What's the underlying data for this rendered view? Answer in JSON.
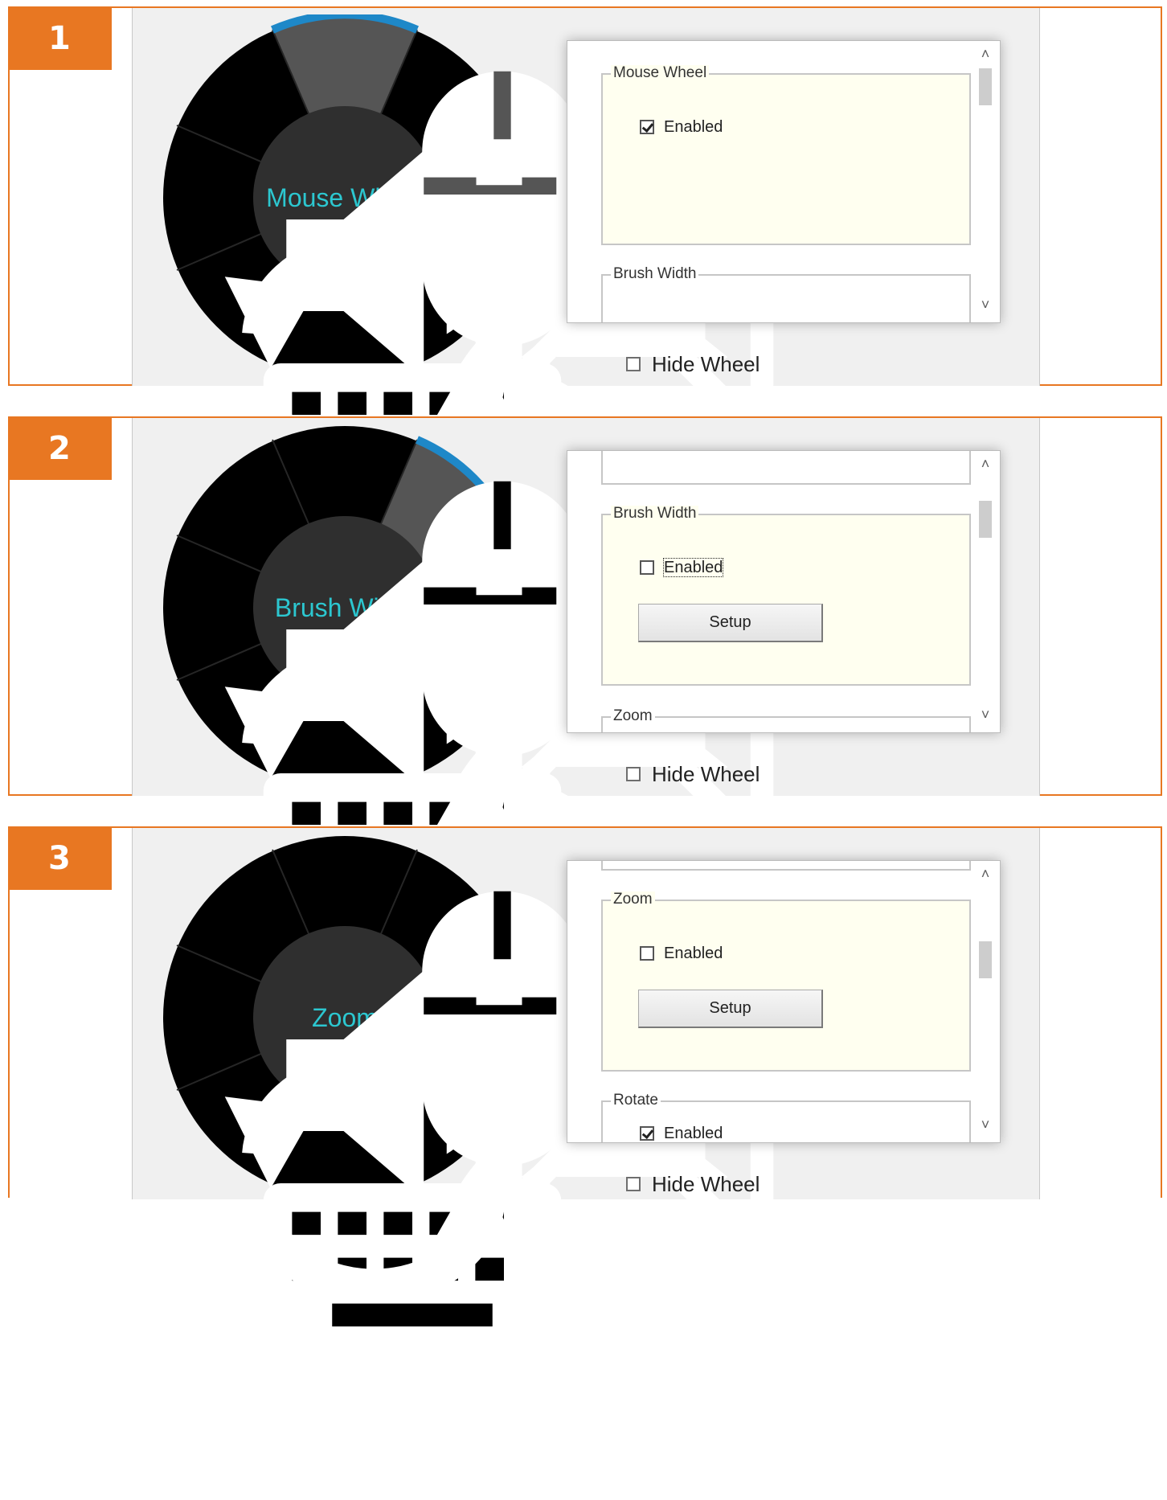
{
  "steps": [
    {
      "number": "1",
      "wheel_label": "Mouse Wheel",
      "groups": [
        {
          "title": "Mouse Wheel",
          "checkbox_label": "Enabled",
          "checked": true
        },
        {
          "title": "Brush Width"
        }
      ],
      "hide_wheel_label": "Hide Wheel",
      "hide_wheel_checked": false
    },
    {
      "number": "2",
      "wheel_label": "Brush Width",
      "groups": [
        {
          "title": "Brush Width",
          "checkbox_label": "Enabled",
          "checked": false,
          "button_label": "Setup"
        },
        {
          "title": "Zoom"
        }
      ],
      "hide_wheel_label": "Hide Wheel",
      "hide_wheel_checked": false
    },
    {
      "number": "3",
      "wheel_label": "Zoom",
      "groups": [
        {
          "title": "Zoom",
          "checkbox_label": "Enabled",
          "checked": false,
          "button_label": "Setup"
        },
        {
          "title": "Rotate",
          "checkbox_label": "Enabled",
          "checked": true
        }
      ],
      "hide_wheel_label": "Hide Wheel",
      "hide_wheel_checked": false
    }
  ],
  "wheel_segments": [
    "mouse-icon",
    "list-icon",
    "fit-screen-icon",
    "rotate-screen-icon",
    "close-icon",
    "keyboard-icon",
    "swap-icon",
    "volume-icon"
  ],
  "scrollbar": {
    "up": "˄",
    "down": "˅"
  },
  "colors": {
    "accent_orange": "#e87722",
    "wheel_highlight": "#1e88c8",
    "wheel_label": "#2cc7d0",
    "group_bg": "#fffff0"
  }
}
